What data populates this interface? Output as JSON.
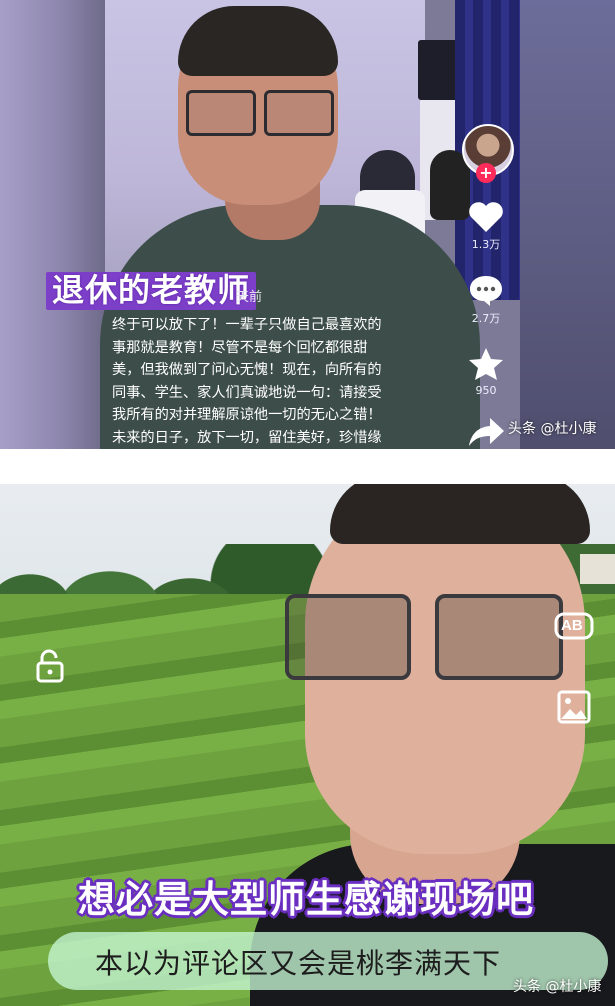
{
  "top_panel": {
    "title_tag": "退休的老教师",
    "days_ago": "天前",
    "caption_lines": [
      "终于可以放下了！一辈子只做自己最喜欢的",
      "事那就是教育！尽管不是每个回忆都很甜",
      "美，但我做到了问心无愧！现在，向所有的",
      "同事、学生、家人们真诚地说一句：请接受",
      "我所有的对并理解原谅他一切的无心之错！",
      "未来的日子，放下一切，留住美好，珍惜缘"
    ],
    "follow_plus": "+",
    "likes": "1.3万",
    "comments": "2.7万",
    "favorites": "950",
    "watermark": "头条 @杜小康"
  },
  "bottom_panel": {
    "caption_big": "想必是大型师生感谢现场吧",
    "subtitle": "本以为评论区又会是桃李满天下",
    "ab_label": "AB",
    "watermark": "头条 @杜小康"
  },
  "colors": {
    "accent_purple": "#7c3fc8",
    "follow_red": "#ff2b5a",
    "subtitle_pill": "#c5f6d4"
  },
  "icons": [
    "heart-icon",
    "comment-icon",
    "star-icon",
    "share-icon",
    "unlock-icon",
    "translate-icon",
    "image-icon"
  ]
}
